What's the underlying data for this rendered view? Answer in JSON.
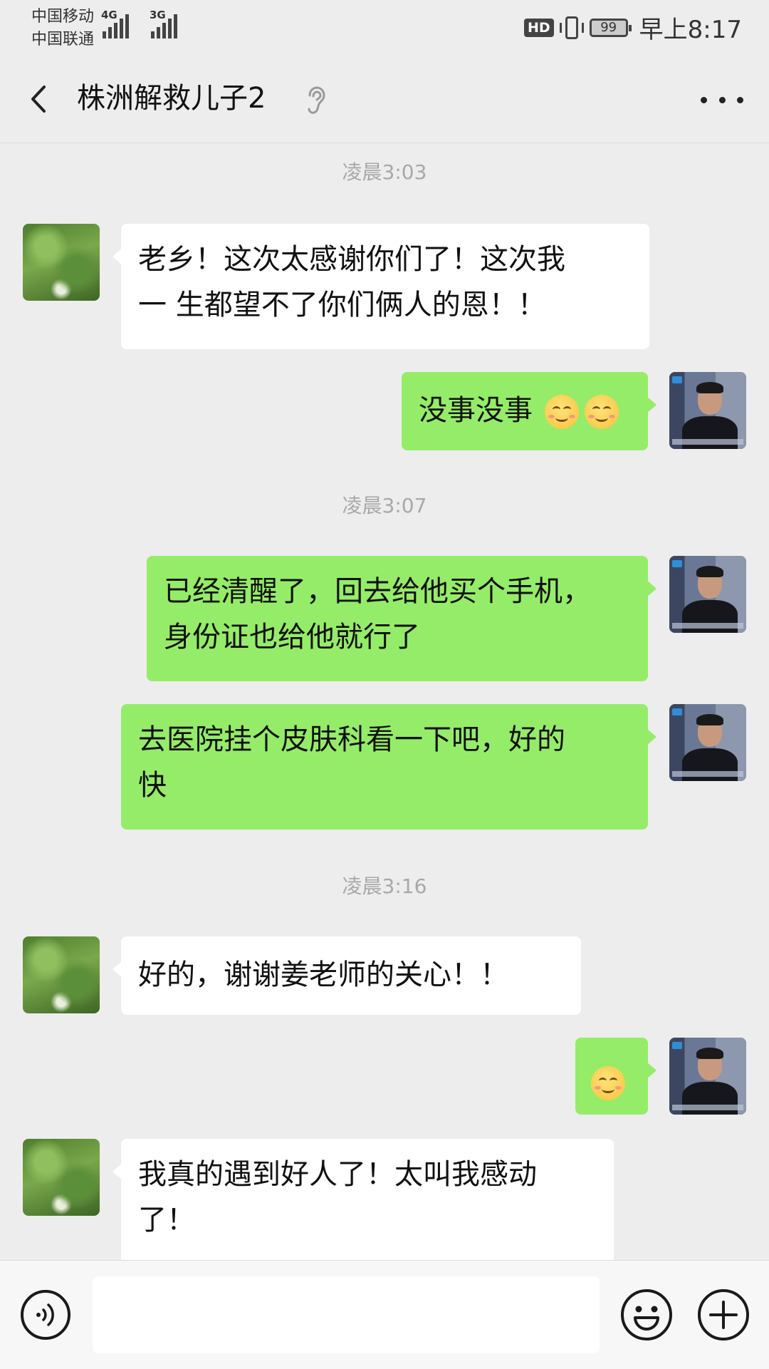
{
  "status_bar": {
    "carrier_1": "中国移动",
    "carrier_2": "中国联通",
    "net_1": "4G",
    "net_2": "3G",
    "hd": "HD",
    "battery": "99",
    "time": "早上8:17"
  },
  "header": {
    "title": "株洲解救儿子2",
    "back_icon": "chevron-left-icon",
    "ear_icon": "ear-icon",
    "more_icon": "more-dots-icon"
  },
  "timestamps": [
    "凌晨3:03",
    "凌晨3:07",
    "凌晨3:16"
  ],
  "messages": [
    {
      "side": "in",
      "text_lines": [
        "老乡！这次太感谢你们了！这次我",
        "一 生都望不了你们俩人的恩！！"
      ]
    },
    {
      "side": "out",
      "text": "没事没事",
      "emoji_count": 2
    },
    {
      "side": "out",
      "text_lines": [
        "已经清醒了，回去给他买个手机，",
        "身份证也给他就行了"
      ]
    },
    {
      "side": "out",
      "text_lines": [
        "去医院挂个皮肤科看一下吧，好的",
        "快"
      ]
    },
    {
      "side": "in",
      "text": "好的，谢谢姜老师的关心！！"
    },
    {
      "side": "out",
      "text": "",
      "emoji_count": 1
    },
    {
      "side": "in",
      "text_lines": [
        "我真的遇到好人了！太叫我感动",
        "了！"
      ]
    }
  ],
  "input_bar": {
    "voice_icon": "voice-icon",
    "emoji_icon": "emoji-icon",
    "plus_icon": "plus-icon",
    "text_value": ""
  },
  "colors": {
    "background": "#ededed",
    "incoming_bubble": "#ffffff",
    "outgoing_bubble": "#95ec69",
    "timestamp": "#a8a8a8"
  }
}
